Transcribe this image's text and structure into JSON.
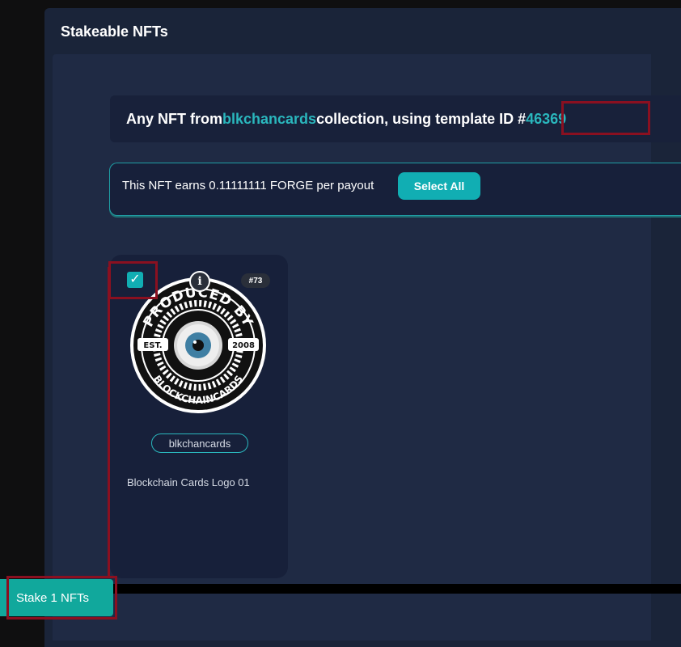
{
  "modal": {
    "title": "Stakeable NFTs"
  },
  "template_info": {
    "prefix": "Any NFT from ",
    "collection": "blkchancards",
    "middle": " collection, using template ID #",
    "template_id": "46369"
  },
  "earnings": {
    "text": "This NFT earns 0.11111111 FORGE per payout",
    "select_all_label": "Select All"
  },
  "nft_card": {
    "checked": true,
    "checkbox_glyph": "✓",
    "info_glyph": "i",
    "mint_number": "#73",
    "image_lettering": [
      "PRODUCED BY",
      "EST.",
      "2008",
      "BLOCKCHAINCARDS"
    ],
    "collection": "blkchancards",
    "name": "Blockchain Cards Logo 01"
  },
  "stake_button": {
    "label": "Stake 1 NFTs"
  },
  "colors": {
    "accent": "#11aeb3",
    "teal_text": "#2ab7bd",
    "highlight_frame": "#8a1020",
    "modal_bg": "#1a2439",
    "panel_bg": "#1f2a44"
  }
}
